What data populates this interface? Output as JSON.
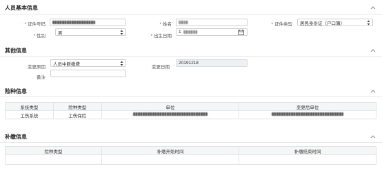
{
  "sections": {
    "basic": {
      "title": "人员基本信息"
    },
    "other": {
      "title": "其他信息"
    },
    "insurance": {
      "title": "险种信息"
    },
    "supplement": {
      "title": "补缴信息"
    }
  },
  "basic": {
    "id_number_label": "证件号码",
    "name_label": "姓名",
    "id_type_label": "证件类型",
    "id_type_value": "居民身份证（户口簿）",
    "gender_label": "性别",
    "gender_value": "男",
    "birth_label": "出生日期",
    "birth_prefix": "1"
  },
  "other": {
    "reason_label": "变更原因",
    "reason_value": "人员中断缴费",
    "change_date_label": "变更日期",
    "change_date_value": "20191218",
    "remark_label": "备注",
    "remark_value": ""
  },
  "insurance_table": {
    "headers": [
      "系统类型",
      "险种类型",
      "单位",
      "变更后单位"
    ],
    "rows": [
      {
        "system_type": "工伤系统",
        "insurance_type": "工伤保险"
      }
    ]
  },
  "supplement_table": {
    "headers": [
      "险种类型",
      "补缴开始时间",
      "补缴结束时间"
    ]
  },
  "icons": {
    "chevron": "chevron-up-icon",
    "calendar": "calendar-icon",
    "select": "select-arrows-icon"
  },
  "colors": {
    "required": "#e02020",
    "disabled_bg": "#eef0f4"
  }
}
